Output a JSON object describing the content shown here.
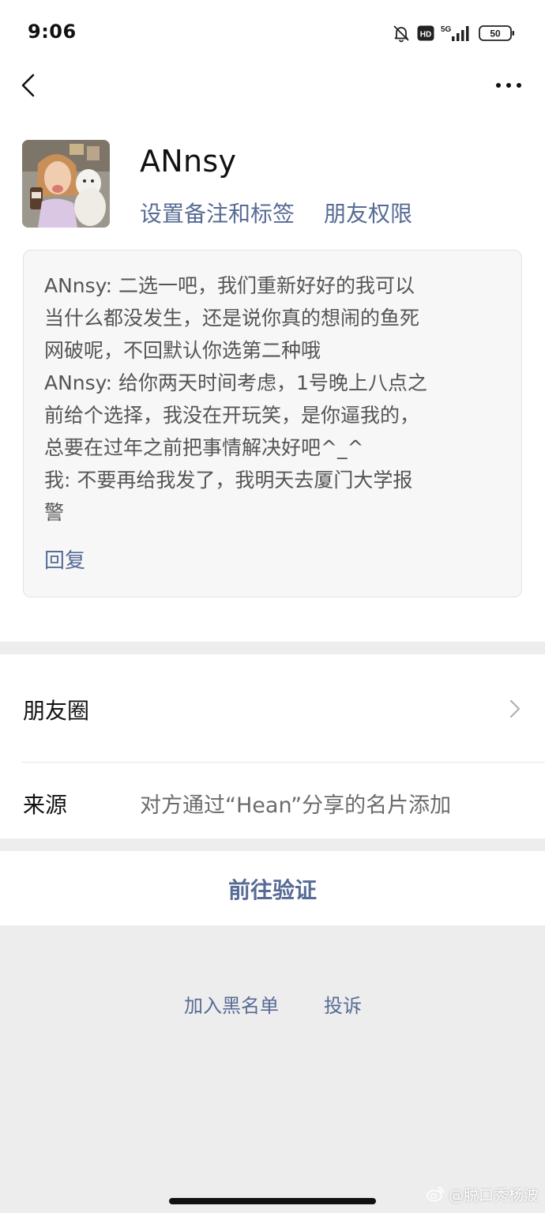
{
  "status_bar": {
    "time": "9:06",
    "network": "5G",
    "hd_badge": "HD",
    "battery": "50",
    "icons": [
      "bell-muted-icon",
      "hd-icon",
      "signal-5g-icon",
      "battery-icon"
    ]
  },
  "nav": {
    "back_icon": "chevron-left-icon",
    "more_icon": "more-dots-icon"
  },
  "profile": {
    "name": "ANnsy",
    "avatar_icon": "avatar-photo",
    "set_remark_label": "设置备注和标签",
    "permissions_label": "朋友权限"
  },
  "message": {
    "lines": [
      "ANnsy: 二选一吧，我们重新好好的我可以",
      "当什么都没发生，还是说你真的想闹的鱼死",
      "网破呢，不回默认你选第二种哦",
      "ANnsy: 给你两天时间考虑，1号晚上八点之",
      "前给个选择，我没在开玩笑，是你逼我的，",
      "总要在过年之前把事情解决好吧^_^",
      "我: 不要再给我发了，我明天去厦门大学报",
      "警"
    ],
    "reply_label": "回复"
  },
  "info": {
    "moments_label": "朋友圈",
    "source_label": "来源",
    "source_value": "对方通过“Hean”分享的名片添加"
  },
  "actions": {
    "verify_label": "前往验证",
    "blacklist_label": "加入黑名单",
    "report_label": "投诉"
  },
  "watermark": {
    "icon": "weibo-icon",
    "text": "@脱口秀杨波"
  },
  "colors": {
    "link": "#576b95",
    "page_background": "#ededed",
    "card_background": "#ffffff",
    "message_background": "#f7f7f7"
  }
}
